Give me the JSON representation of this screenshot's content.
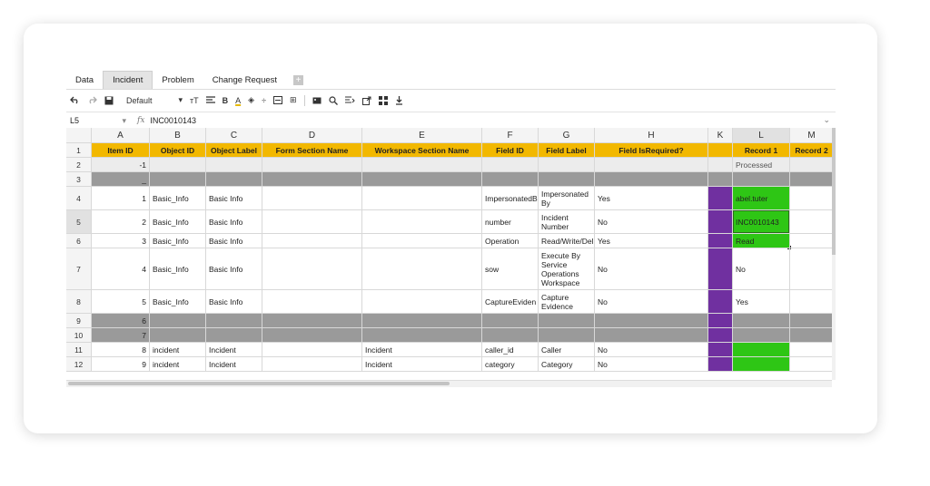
{
  "tabs": [
    "Data",
    "Incident",
    "Problem",
    "Change Request"
  ],
  "tab_add": "+",
  "toolbar": {
    "font": "Default",
    "font_size_glyph": "тT",
    "bold": "B",
    "text_color": "A",
    "fill_color_glyph": "◈",
    "merge_glyph": "÷",
    "borders_glyph": "⊞",
    "search_glyph": "🔍",
    "download_glyph": "⭳"
  },
  "formula_bar": {
    "cell_ref": "L5",
    "fx": "fx",
    "value": "INC0010143"
  },
  "columns": [
    "A",
    "B",
    "C",
    "D",
    "E",
    "F",
    "G",
    "H",
    "K",
    "L",
    "M"
  ],
  "rows": [
    {
      "n": "1",
      "cells": [
        "Item ID",
        "Object ID",
        "Object Label",
        "Form Section Name",
        "Workspace Section Name",
        "Field ID",
        "Field Label",
        "Field IsRequired?",
        "",
        "Record 1",
        "Record 2"
      ]
    },
    {
      "n": "2",
      "cells": [
        "-1",
        "",
        "",
        "",
        "",
        "",
        "",
        "",
        "",
        "Processed",
        ""
      ]
    },
    {
      "n": "3",
      "cells": [
        "_",
        "",
        "",
        "",
        "",
        "",
        "",
        "",
        "",
        "",
        ""
      ]
    },
    {
      "n": "4",
      "cells": [
        "1",
        "Basic_Info",
        "Basic Info",
        "",
        "",
        "ImpersonatedB",
        "Impersonated By",
        "Yes",
        "",
        "abel.tuter",
        ""
      ]
    },
    {
      "n": "5",
      "cells": [
        "2",
        "Basic_Info",
        "Basic Info",
        "",
        "",
        "number",
        "Incident Number",
        "No",
        "",
        "INC0010143",
        ""
      ]
    },
    {
      "n": "6",
      "cells": [
        "3",
        "Basic_Info",
        "Basic Info",
        "",
        "",
        "Operation",
        "Read/Write/Del",
        "Yes",
        "",
        "Read",
        ""
      ]
    },
    {
      "n": "7",
      "cells": [
        "4",
        "Basic_Info",
        "Basic Info",
        "",
        "",
        "sow",
        "Execute By Service Operations Workspace",
        "No",
        "",
        "No",
        ""
      ]
    },
    {
      "n": "8",
      "cells": [
        "5",
        "Basic_Info",
        "Basic Info",
        "",
        "",
        "CaptureEviden",
        "Capture Evidence",
        "No",
        "",
        "Yes",
        ""
      ]
    },
    {
      "n": "9",
      "cells": [
        "6",
        "",
        "",
        "",
        "",
        "",
        "",
        "",
        "",
        "",
        ""
      ]
    },
    {
      "n": "10",
      "cells": [
        "7",
        "",
        "",
        "",
        "",
        "",
        "",
        "",
        "",
        "",
        ""
      ]
    },
    {
      "n": "11",
      "cells": [
        "8",
        "incident",
        "Incident",
        "",
        "Incident",
        "caller_id",
        "Caller",
        "No",
        "",
        "",
        ""
      ]
    },
    {
      "n": "12",
      "cells": [
        "9",
        "incident",
        "Incident",
        "",
        "Incident",
        "category",
        "Category",
        "No",
        "",
        "",
        ""
      ]
    }
  ],
  "colors": {
    "header_yellow": "#f2b800",
    "gray_row": "#9a9a9a",
    "purple": "#7030a0",
    "green": "#2ec615"
  }
}
